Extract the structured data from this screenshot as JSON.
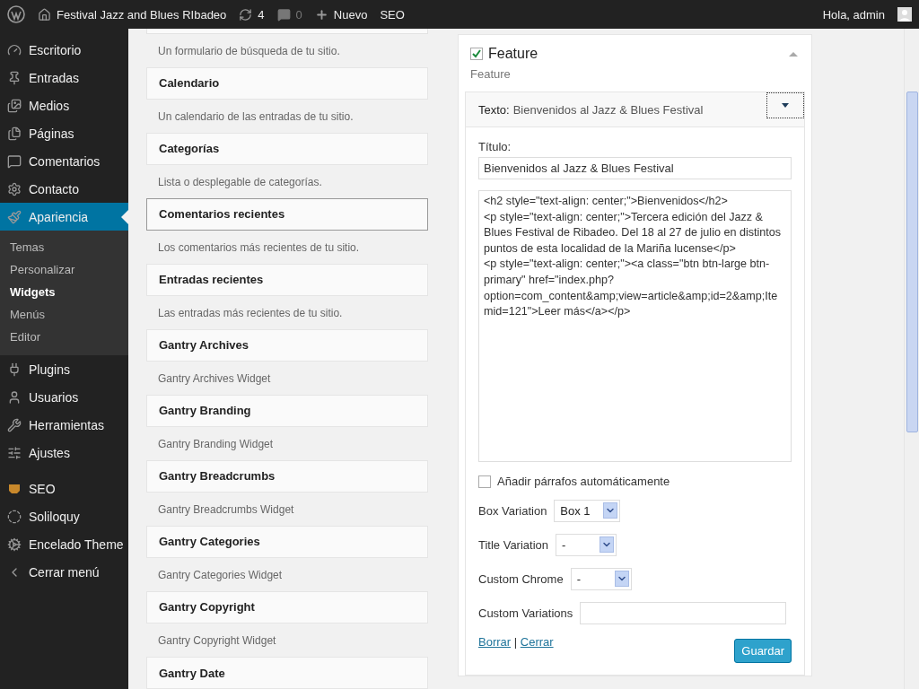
{
  "admin_bar": {
    "site_name": "Festival Jazz and Blues RIbadeo",
    "updates": "4",
    "comments": "0",
    "new": "Nuevo",
    "seo": "SEO",
    "greeting": "Hola, admin"
  },
  "menu": [
    {
      "label": "Escritorio",
      "selected": false
    },
    {
      "label": "Entradas",
      "selected": false
    },
    {
      "label": "Medios",
      "selected": false
    },
    {
      "label": "Páginas",
      "selected": false
    },
    {
      "label": "Comentarios",
      "selected": false
    },
    {
      "label": "Contacto",
      "selected": false
    },
    {
      "label": "Apariencia",
      "selected": true,
      "children": [
        {
          "label": "Temas",
          "selected": false
        },
        {
          "label": "Personalizar",
          "selected": false
        },
        {
          "label": "Widgets",
          "selected": true
        },
        {
          "label": "Menús",
          "selected": false
        },
        {
          "label": "Editor",
          "selected": false
        }
      ]
    },
    {
      "label": "Plugins",
      "selected": false
    },
    {
      "label": "Usuarios",
      "selected": false
    },
    {
      "label": "Herramientas",
      "selected": false
    },
    {
      "label": "Ajustes",
      "selected": false
    },
    {
      "label": "SEO",
      "selected": false
    },
    {
      "label": "Soliloquy",
      "selected": false
    },
    {
      "label": "Encelado Theme",
      "selected": false
    },
    {
      "label": "Cerrar menú",
      "selected": false
    }
  ],
  "widgets_top_description": "Un formulario de búsqueda de tu sitio.",
  "widgets": [
    {
      "name": "Calendario",
      "description": "Un calendario de las entradas de tu sitio.",
      "selected": false
    },
    {
      "name": "Categorías",
      "description": "Lista o desplegable de categorías.",
      "selected": false
    },
    {
      "name": "Comentarios recientes",
      "description": "Los comentarios más recientes de tu sitio.",
      "selected": true
    },
    {
      "name": "Entradas recientes",
      "description": "Las entradas más recientes de tu sitio.",
      "selected": false
    },
    {
      "name": "Gantry Archives",
      "description": "Gantry Archives Widget",
      "selected": false
    },
    {
      "name": "Gantry Branding",
      "description": "Gantry Branding Widget",
      "selected": false
    },
    {
      "name": "Gantry Breadcrumbs",
      "description": "Gantry Breadcrumbs Widget",
      "selected": false
    },
    {
      "name": "Gantry Categories",
      "description": "Gantry Categories Widget",
      "selected": false
    },
    {
      "name": "Gantry Copyright",
      "description": "Gantry Copyright Widget",
      "selected": false
    },
    {
      "name": "Gantry Date",
      "selected": false
    }
  ],
  "sidebar_area": {
    "title": "Feature",
    "checked": true,
    "description": "Feature",
    "widget": {
      "type_label": "Texto:",
      "title": "Bienvenidos al Jazz & Blues Festival",
      "expanded": true,
      "title_label": "Título:",
      "title_value": "Bienvenidos al Jazz & Blues Festival",
      "content": "<h2 style=\"text-align: center;\">Bienvenidos</h2>\n<p style=\"text-align: center;\">Tercera edición del Jazz & Blues Festival de Ribadeo. Del 18 al 27 de julio en distintos puntos de esta localidad de la Mariña lucense</p>\n<p style=\"text-align: center;\"><a class=\"btn btn-large btn-primary\" href=\"index.php?option=com_content&amp;view=article&amp;id=2&amp;Itemid=121\">Leer más</a></p>",
      "auto_paragraphs": {
        "label": "Añadir párrafos automáticamente",
        "checked": false
      },
      "fields": [
        {
          "kind": "select",
          "label": "Box Variation",
          "value": "Box 1"
        },
        {
          "kind": "select",
          "label": "Title Variation",
          "value": "-"
        },
        {
          "kind": "select",
          "label": "Custom Chrome",
          "value": "-"
        },
        {
          "kind": "text",
          "label": "Custom Variations"
        }
      ],
      "delete": "Borrar",
      "separator": "|",
      "close": "Cerrar",
      "save": "Guardar"
    }
  }
}
